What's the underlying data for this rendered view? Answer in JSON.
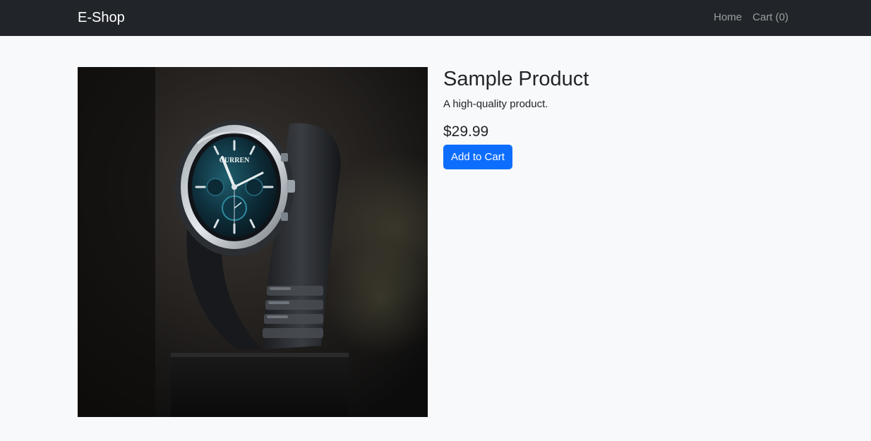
{
  "navbar": {
    "brand": "E-Shop",
    "links": {
      "home": "Home",
      "cart_label": "Cart",
      "cart_count": "0"
    }
  },
  "product": {
    "title": "Sample Product",
    "description": "A high-quality product.",
    "price": "$29.99",
    "add_to_cart_label": "Add to Cart",
    "image_brand": "CURREN"
  },
  "colors": {
    "navbar_bg": "#212529",
    "page_bg": "#f8f9fa",
    "primary": "#0d6efd"
  }
}
